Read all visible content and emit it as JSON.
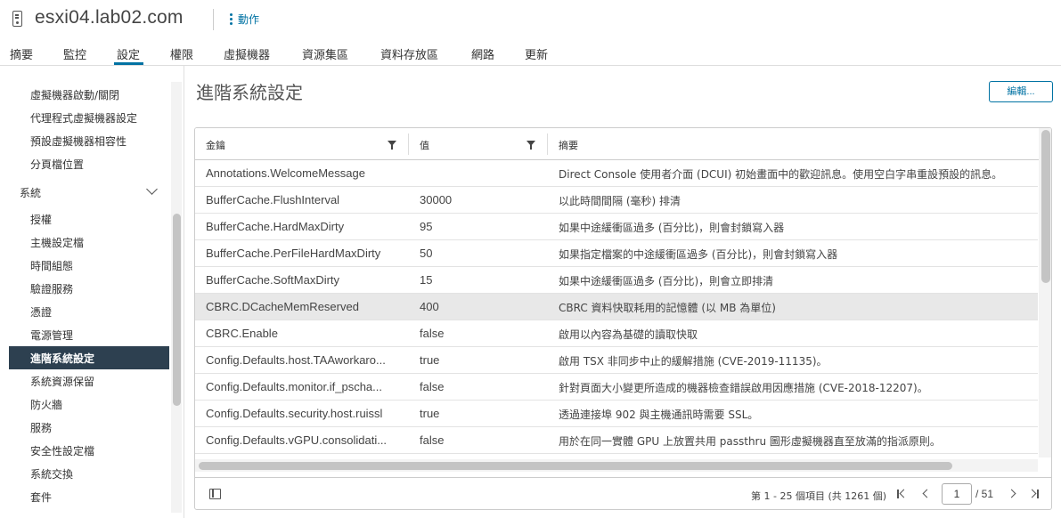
{
  "header": {
    "host_name": "esxi04.lab02.com",
    "actions_label": "動作"
  },
  "tabs": [
    {
      "label": "摘要"
    },
    {
      "label": "監控"
    },
    {
      "label": "設定"
    },
    {
      "label": "權限"
    },
    {
      "label": "虛擬機器"
    },
    {
      "label": "資源集區"
    },
    {
      "label": "資料存放區"
    },
    {
      "label": "網路"
    },
    {
      "label": "更新"
    }
  ],
  "active_tab": "設定",
  "sidebar": {
    "items_top": [
      {
        "label": "虛擬機器啟動/關閉"
      },
      {
        "label": "代理程式虛擬機器設定"
      },
      {
        "label": "預設虛擬機器相容性"
      },
      {
        "label": "分頁檔位置"
      }
    ],
    "group": {
      "label": "系統"
    },
    "items_system": [
      {
        "label": "授權"
      },
      {
        "label": "主機設定檔"
      },
      {
        "label": "時間組態"
      },
      {
        "label": "驗證服務"
      },
      {
        "label": "憑證"
      },
      {
        "label": "電源管理"
      },
      {
        "label": "進階系統設定"
      },
      {
        "label": "系統資源保留"
      },
      {
        "label": "防火牆"
      },
      {
        "label": "服務"
      },
      {
        "label": "安全性設定檔"
      },
      {
        "label": "系統交換"
      },
      {
        "label": "套件"
      }
    ],
    "active_item": "進階系統設定"
  },
  "main": {
    "title": "進階系統設定",
    "edit_label": "編輯..."
  },
  "grid": {
    "columns": [
      {
        "label": "金鑰"
      },
      {
        "label": "值"
      },
      {
        "label": "摘要"
      }
    ],
    "rows": [
      {
        "key": "Annotations.WelcomeMessage",
        "value": "",
        "summary": "Direct Console 使用者介面 (DCUI) 初始畫面中的歡迎訊息。使用空白字串重設預設的訊息。"
      },
      {
        "key": "BufferCache.FlushInterval",
        "value": "30000",
        "summary": "以此時間間隔 (毫秒) 排清"
      },
      {
        "key": "BufferCache.HardMaxDirty",
        "value": "95",
        "summary": "如果中途緩衝區過多 (百分比)，則會封鎖寫入器"
      },
      {
        "key": "BufferCache.PerFileHardMaxDirty",
        "value": "50",
        "summary": "如果指定檔案的中途緩衝區過多 (百分比)，則會封鎖寫入器"
      },
      {
        "key": "BufferCache.SoftMaxDirty",
        "value": "15",
        "summary": "如果中途緩衝區過多 (百分比)，則會立即排清"
      },
      {
        "key": "CBRC.DCacheMemReserved",
        "value": "400",
        "summary": "CBRC 資料快取耗用的記憶體 (以 MB 為單位)"
      },
      {
        "key": "CBRC.Enable",
        "value": "false",
        "summary": "啟用以內容為基礎的讀取快取"
      },
      {
        "key": "Config.Defaults.host.TAAworkaro...",
        "value": "true",
        "summary": "啟用 TSX 非同步中止的緩解措施 (CVE-2019-11135)。"
      },
      {
        "key": "Config.Defaults.monitor.if_pscha...",
        "value": "false",
        "summary": "針對頁面大小變更所造成的機器檢查錯誤啟用因應措施 (CVE-2018-12207)。"
      },
      {
        "key": "Config.Defaults.security.host.ruissl",
        "value": "true",
        "summary": "透過連接埠 902 與主機通訊時需要 SSL。"
      },
      {
        "key": "Config.Defaults.vGPU.consolidati...",
        "value": "false",
        "summary": "用於在同一實體 GPU 上放置共用 passthru 圖形虛擬機器直至放滿的指派原則。"
      }
    ],
    "selected_row_key": "CBRC.DCacheMemReserved",
    "footer": {
      "count_text": "第 1 - 25 個項目 (共 1261 個)",
      "current_page": "1",
      "total_pages": "/ 51"
    }
  },
  "colors": {
    "accent": "#0072a3",
    "sidebar_active_bg": "#2d4050",
    "selected_row_bg": "#e8e8e8"
  }
}
